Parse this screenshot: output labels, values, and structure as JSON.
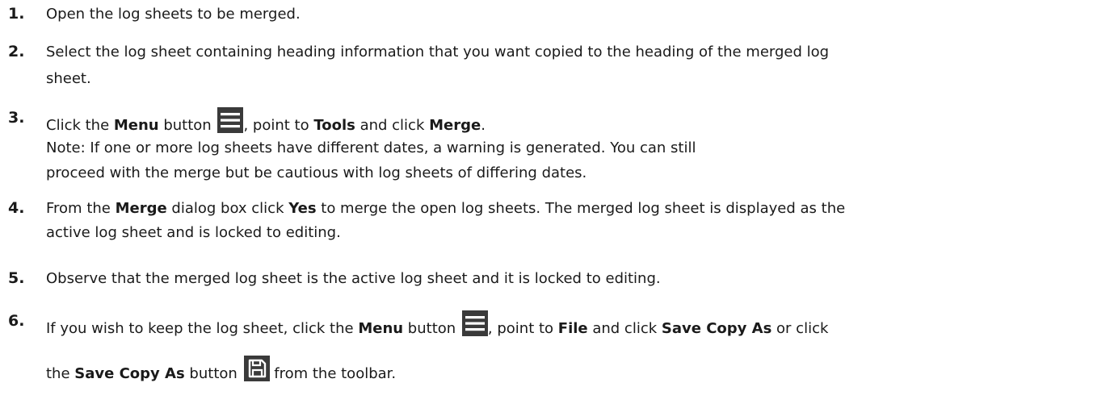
{
  "steps": [
    {
      "num": "1.",
      "lines": [
        {
          "parts": [
            {
              "t": "Open the log sheets to be merged."
            }
          ]
        }
      ]
    },
    {
      "num": "2.",
      "lines": [
        {
          "parts": [
            {
              "t": "Select the log sheet containing heading information that you want copied to the heading of the merged log"
            }
          ]
        },
        {
          "parts": [
            {
              "t": "sheet."
            }
          ]
        }
      ]
    },
    {
      "num": "3.",
      "lines": [
        {
          "parts": [
            {
              "t": "Click the "
            },
            {
              "t": "Menu",
              "b": true
            },
            {
              "t": " button "
            },
            {
              "icon": "menu-icon"
            },
            {
              "t": ", point to "
            },
            {
              "t": "Tools",
              "b": true
            },
            {
              "t": " and click "
            },
            {
              "t": "Merge",
              "b": true
            },
            {
              "t": "."
            }
          ]
        },
        {
          "parts": [
            {
              "t": "Note: If one or more log sheets have different dates, a warning is generated.  You can still"
            }
          ]
        },
        {
          "parts": [
            {
              "t": "proceed with the merge but be cautious with log sheets of differing dates."
            }
          ]
        }
      ]
    },
    {
      "num": "4.",
      "lines": [
        {
          "parts": [
            {
              "t": "From the "
            },
            {
              "t": "Merge",
              "b": true
            },
            {
              "t": " dialog box click "
            },
            {
              "t": "Yes",
              "b": true
            },
            {
              "t": " to merge the open log sheets.  The merged log sheet is displayed as the"
            }
          ]
        },
        {
          "parts": [
            {
              "t": "active log sheet and is locked to editing."
            }
          ]
        }
      ]
    },
    {
      "num": "5.",
      "lines": [
        {
          "parts": [
            {
              "t": "Observe that the merged log sheet is the active log sheet and it is locked to editing."
            }
          ]
        }
      ]
    },
    {
      "num": "6.",
      "lines": [
        {
          "parts": [
            {
              "t": "If you wish to keep the log sheet, click the "
            },
            {
              "t": "Menu",
              "b": true
            },
            {
              "t": " button "
            },
            {
              "icon": "menu-icon"
            },
            {
              "t": ", point to "
            },
            {
              "t": "File",
              "b": true
            },
            {
              "t": " and click "
            },
            {
              "t": "Save Copy As",
              "b": true
            },
            {
              "t": " or click"
            }
          ]
        },
        {
          "parts": [
            {
              "t": "the "
            },
            {
              "t": "Save Copy As",
              "b": true
            },
            {
              "t": " button "
            },
            {
              "icon": "save-icon"
            },
            {
              "t": " from the toolbar."
            }
          ]
        }
      ]
    }
  ]
}
